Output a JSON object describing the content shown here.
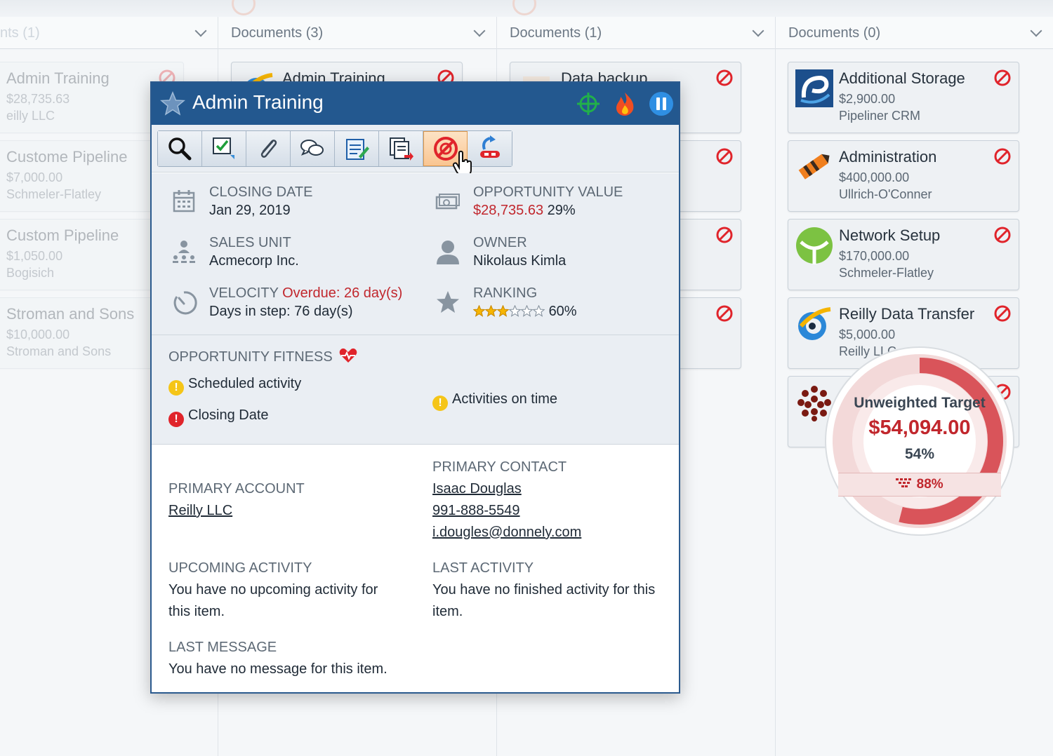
{
  "columns": [
    {
      "label": "nts (1)"
    },
    {
      "label": "Documents (3)"
    },
    {
      "label": "Documents (1)"
    },
    {
      "label": "Documents (0)"
    }
  ],
  "left_cards": [
    {
      "title": "Admin Training",
      "value": "$28,735.63",
      "org": "eilly LLC"
    },
    {
      "title": "Custome Pipeline",
      "value": "$7,000.00",
      "org": "Schmeler-Flatley"
    },
    {
      "title": "Custom Pipeline",
      "value": "$1,050.00",
      "org": "Bogisich"
    },
    {
      "title": "Stroman and Sons",
      "value": "$10,000.00",
      "org": "Stroman and Sons"
    }
  ],
  "mid_cards": [
    {
      "title": "Admin Training"
    }
  ],
  "col3_cards": [
    {
      "title": "Data backup"
    }
  ],
  "right_cards": [
    {
      "title": "Additional Storage",
      "value": "$2,900.00",
      "org": "Pipeliner CRM",
      "logo": "pipeliner-logo"
    },
    {
      "title": "Administration",
      "value": "$400,000.00",
      "org": "Ullrich-O'Conner",
      "logo": "pencil-logo"
    },
    {
      "title": "Network Setup",
      "value": "$170,000.00",
      "org": "Schmeler-Flatley",
      "logo": "leaf-logo"
    },
    {
      "title": "Reilly Data Transfer",
      "value": "$5,000.00",
      "org": "Reilly LLC",
      "logo": "swirl-logo"
    },
    {
      "title": "",
      "value": "",
      "org": "",
      "logo": "dots-logo"
    }
  ],
  "popup": {
    "title": "Admin Training",
    "toolbar": [
      "magnifier-icon",
      "task-check-icon",
      "paperclip-icon",
      "chat-bubbles-icon",
      "notepad-edit-icon",
      "documents-export-icon",
      "no-link-icon",
      "unlink-export-icon"
    ],
    "closing_date": {
      "label": "CLOSING DATE",
      "value": "Jan 29, 2019"
    },
    "opportunity_value": {
      "label": "OPPORTUNITY VALUE",
      "amount": "$28,735.63",
      "percent": "29%"
    },
    "sales_unit": {
      "label": "SALES UNIT",
      "value": "Acmecorp Inc."
    },
    "owner": {
      "label": "OWNER",
      "value": "Nikolaus Kimla"
    },
    "velocity": {
      "label": "VELOCITY",
      "overdue": "Overdue: 26 day(s)",
      "days_in_step": "Days in step: 76 day(s)"
    },
    "ranking": {
      "label": "RANKING",
      "stars": 3,
      "max_stars": 6,
      "percent": "60%"
    },
    "fitness": {
      "title": "OPPORTUNITY FITNESS",
      "scheduled_activity": "Scheduled activity",
      "closing_date": "Closing Date",
      "activities_on_time": "Activities on time"
    },
    "primary_account": {
      "label": "PRIMARY ACCOUNT",
      "value": "Reilly LLC"
    },
    "primary_contact": {
      "label": "PRIMARY CONTACT",
      "name": "Isaac Douglas",
      "phone": "991-888-5549",
      "email": "i.dougles@donnely.com"
    },
    "upcoming_activity": {
      "label": "UPCOMING ACTIVITY",
      "text": "You have no upcoming activity for this item."
    },
    "last_activity": {
      "label": "LAST ACTIVITY",
      "text": "You have no finished activity for this item."
    },
    "last_message": {
      "label": "LAST MESSAGE",
      "text": "You have no message for this item."
    }
  },
  "target": {
    "title": "Unweighted Target",
    "value": "$54,094.00",
    "percent": "54%",
    "weighted_percent": "88%",
    "fill_fraction": 0.54
  },
  "colors": {
    "header": "#23588f",
    "accent_red": "#c1272d",
    "panel": "#eaeef3"
  }
}
